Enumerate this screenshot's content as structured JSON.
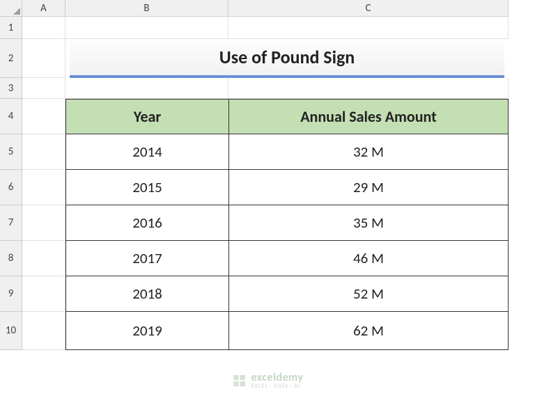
{
  "columns": [
    "A",
    "B",
    "C"
  ],
  "rows": [
    "1",
    "2",
    "3",
    "4",
    "5",
    "6",
    "7",
    "8",
    "9",
    "10"
  ],
  "title": "Use of Pound Sign",
  "table": {
    "headers": {
      "year": "Year",
      "amount": "Annual Sales Amount"
    },
    "data": [
      {
        "year": "2014",
        "amount": "32 M"
      },
      {
        "year": "2015",
        "amount": "29 M"
      },
      {
        "year": "2016",
        "amount": "35 M"
      },
      {
        "year": "2017",
        "amount": "46 M"
      },
      {
        "year": "2018",
        "amount": "52 M"
      },
      {
        "year": "2019",
        "amount": "62 M"
      }
    ]
  },
  "watermark": {
    "name": "exceldemy",
    "tagline": "EXCEL · DATA · BI"
  }
}
